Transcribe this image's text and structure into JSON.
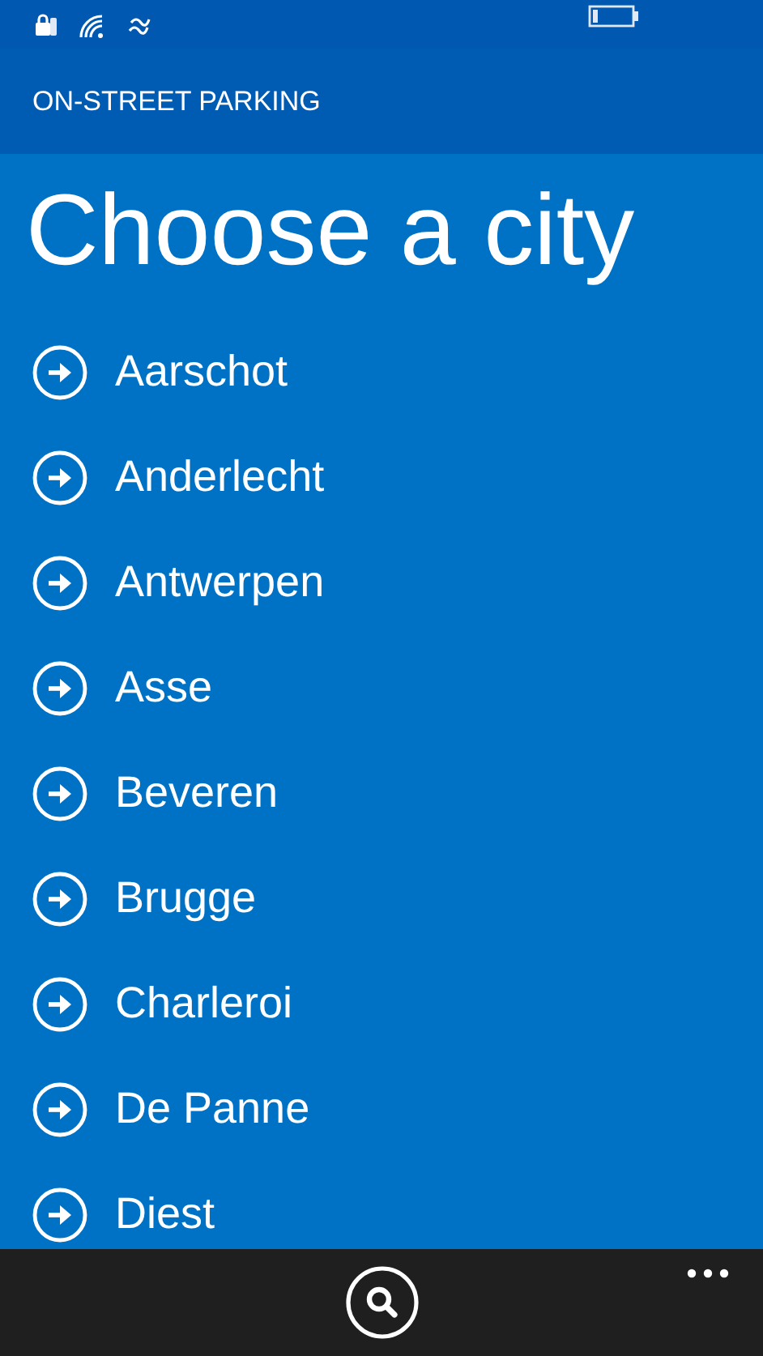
{
  "header": {
    "title": "ON-STREET PARKING"
  },
  "page": {
    "title": "Choose a city"
  },
  "cities": [
    {
      "name": "Aarschot"
    },
    {
      "name": "Anderlecht"
    },
    {
      "name": "Antwerpen"
    },
    {
      "name": "Asse"
    },
    {
      "name": "Beveren"
    },
    {
      "name": "Brugge"
    },
    {
      "name": "Charleroi"
    },
    {
      "name": "De Panne"
    },
    {
      "name": "Diest"
    }
  ]
}
